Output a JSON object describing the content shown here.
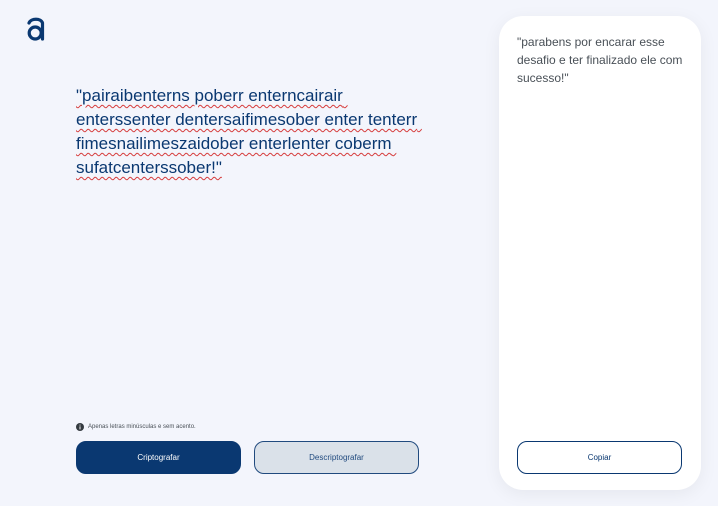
{
  "logo": {
    "icon": "alura-logo-icon",
    "color": "#0a3871"
  },
  "input": {
    "value": "\"pairaibenterns poberr enterncairair enterssenter dentersaifimesober enter tenterr fimesnailimeszaidober enterlenter coberm sufatcenterssober!\""
  },
  "hint": {
    "icon": "info-icon",
    "text": "Apenas letras minúsculas e sem acento."
  },
  "buttons": {
    "encrypt": "Criptografar",
    "decrypt": "Descriptografar"
  },
  "output": {
    "text": "\"parabens por encarar esse desafio e ter finalizado ele com sucesso!\"",
    "copy": "Copiar"
  },
  "colors": {
    "background": "#f3f5fc",
    "primary": "#0a3871",
    "card": "#ffffff",
    "text_muted": "#495057"
  }
}
